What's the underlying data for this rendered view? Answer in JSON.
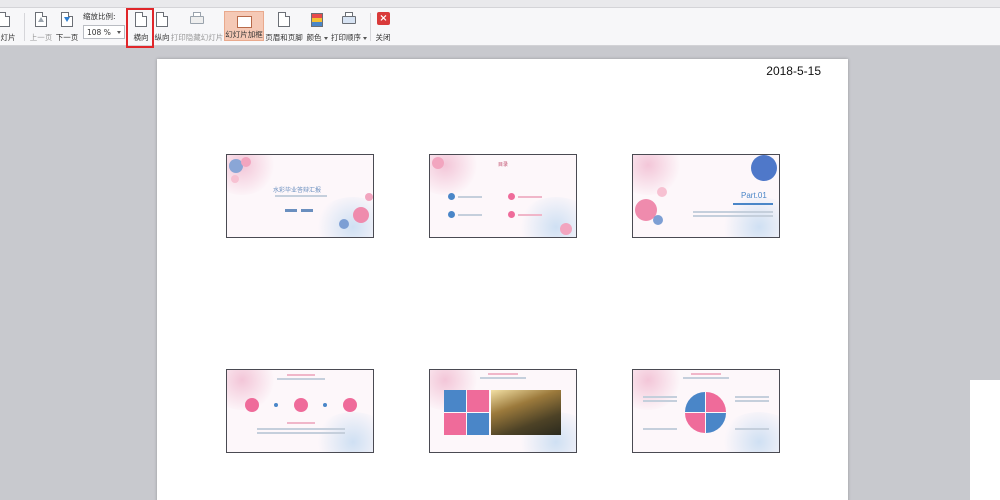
{
  "toolbar": {
    "partial_left_label": "灯片",
    "prev_page": "上一页",
    "next_page": "下一页",
    "zoom_label": "缩放比例:",
    "zoom_value": "108 %",
    "landscape": "横向",
    "portrait": "纵向",
    "print_hidden": "打印隐藏幻灯片",
    "slide_frame": "幻灯片加框",
    "header_footer": "页眉和页脚",
    "color": "颜色",
    "print_order": "打印顺序",
    "close": "关闭"
  },
  "paper": {
    "date": "2018-5-15"
  },
  "slides": [
    {
      "title": "水彩毕业答辩汇报"
    },
    {
      "title": "目录"
    },
    {
      "title": "Part.01"
    },
    {
      "title": ""
    },
    {
      "title": ""
    },
    {
      "title": ""
    }
  ],
  "colors": {
    "pink": "#ef6b9a",
    "blue": "#4a86c8",
    "highlight": "#e0262a"
  }
}
